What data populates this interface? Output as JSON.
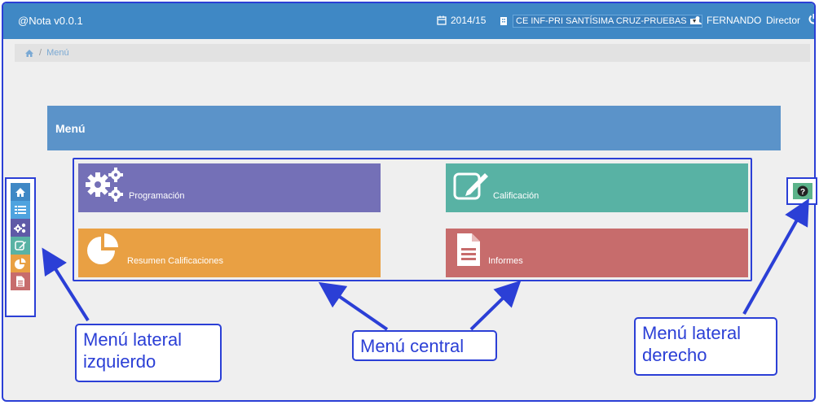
{
  "app": {
    "title": "@Nota v0.0.1"
  },
  "topbar": {
    "year": "2014/15",
    "school": "CE INF-PRI SANTÍSIMA CRUZ-PRUEBAS",
    "user": "FERNANDO",
    "role": "Director"
  },
  "breadcrumb": {
    "current": "Menú"
  },
  "panel": {
    "title": "Menú"
  },
  "tiles": [
    {
      "label": "Programación",
      "color": "#7470b7",
      "icon": "gears-icon"
    },
    {
      "label": "Calificación",
      "color": "#58b2a4",
      "icon": "edit-icon"
    },
    {
      "label": "Resumen Calificaciones",
      "color": "#e9a043",
      "icon": "pie-chart-icon"
    },
    {
      "label": "Informes",
      "color": "#c76c6c",
      "icon": "document-icon"
    }
  ],
  "left_menu": [
    {
      "icon": "home-icon",
      "color": "#3f88c5"
    },
    {
      "icon": "list-icon",
      "color": "#4fa3df"
    },
    {
      "icon": "gears-icon",
      "color": "#5f5aa7"
    },
    {
      "icon": "edit-icon",
      "color": "#58b2a4"
    },
    {
      "icon": "pie-chart-icon",
      "color": "#e9a043"
    },
    {
      "icon": "document-icon",
      "color": "#c76c6c"
    }
  ],
  "right_menu": [
    {
      "icon": "help-icon",
      "color": "#5cb38a"
    }
  ],
  "callouts": {
    "left_line1": "Menú lateral",
    "left_line2": "izquierdo",
    "center": "Menú central",
    "right_line1": "Menú lateral",
    "right_line2": "derecho"
  }
}
